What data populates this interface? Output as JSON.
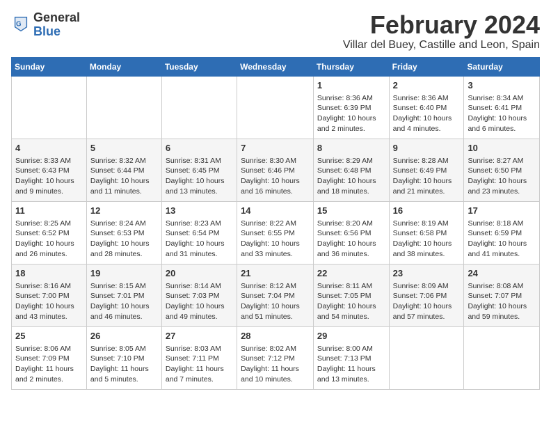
{
  "header": {
    "logo": {
      "general": "General",
      "blue": "Blue",
      "icon_color": "#2e6db4"
    },
    "title": "February 2024",
    "subtitle": "Villar del Buey, Castille and Leon, Spain"
  },
  "weekdays": [
    "Sunday",
    "Monday",
    "Tuesday",
    "Wednesday",
    "Thursday",
    "Friday",
    "Saturday"
  ],
  "weeks": [
    [
      {
        "day": "",
        "content": ""
      },
      {
        "day": "",
        "content": ""
      },
      {
        "day": "",
        "content": ""
      },
      {
        "day": "",
        "content": ""
      },
      {
        "day": "1",
        "content": "Sunrise: 8:36 AM\nSunset: 6:39 PM\nDaylight: 10 hours\nand 2 minutes."
      },
      {
        "day": "2",
        "content": "Sunrise: 8:36 AM\nSunset: 6:40 PM\nDaylight: 10 hours\nand 4 minutes."
      },
      {
        "day": "3",
        "content": "Sunrise: 8:34 AM\nSunset: 6:41 PM\nDaylight: 10 hours\nand 6 minutes."
      }
    ],
    [
      {
        "day": "4",
        "content": "Sunrise: 8:33 AM\nSunset: 6:43 PM\nDaylight: 10 hours\nand 9 minutes."
      },
      {
        "day": "5",
        "content": "Sunrise: 8:32 AM\nSunset: 6:44 PM\nDaylight: 10 hours\nand 11 minutes."
      },
      {
        "day": "6",
        "content": "Sunrise: 8:31 AM\nSunset: 6:45 PM\nDaylight: 10 hours\nand 13 minutes."
      },
      {
        "day": "7",
        "content": "Sunrise: 8:30 AM\nSunset: 6:46 PM\nDaylight: 10 hours\nand 16 minutes."
      },
      {
        "day": "8",
        "content": "Sunrise: 8:29 AM\nSunset: 6:48 PM\nDaylight: 10 hours\nand 18 minutes."
      },
      {
        "day": "9",
        "content": "Sunrise: 8:28 AM\nSunset: 6:49 PM\nDaylight: 10 hours\nand 21 minutes."
      },
      {
        "day": "10",
        "content": "Sunrise: 8:27 AM\nSunset: 6:50 PM\nDaylight: 10 hours\nand 23 minutes."
      }
    ],
    [
      {
        "day": "11",
        "content": "Sunrise: 8:25 AM\nSunset: 6:52 PM\nDaylight: 10 hours\nand 26 minutes."
      },
      {
        "day": "12",
        "content": "Sunrise: 8:24 AM\nSunset: 6:53 PM\nDaylight: 10 hours\nand 28 minutes."
      },
      {
        "day": "13",
        "content": "Sunrise: 8:23 AM\nSunset: 6:54 PM\nDaylight: 10 hours\nand 31 minutes."
      },
      {
        "day": "14",
        "content": "Sunrise: 8:22 AM\nSunset: 6:55 PM\nDaylight: 10 hours\nand 33 minutes."
      },
      {
        "day": "15",
        "content": "Sunrise: 8:20 AM\nSunset: 6:56 PM\nDaylight: 10 hours\nand 36 minutes."
      },
      {
        "day": "16",
        "content": "Sunrise: 8:19 AM\nSunset: 6:58 PM\nDaylight: 10 hours\nand 38 minutes."
      },
      {
        "day": "17",
        "content": "Sunrise: 8:18 AM\nSunset: 6:59 PM\nDaylight: 10 hours\nand 41 minutes."
      }
    ],
    [
      {
        "day": "18",
        "content": "Sunrise: 8:16 AM\nSunset: 7:00 PM\nDaylight: 10 hours\nand 43 minutes."
      },
      {
        "day": "19",
        "content": "Sunrise: 8:15 AM\nSunset: 7:01 PM\nDaylight: 10 hours\nand 46 minutes."
      },
      {
        "day": "20",
        "content": "Sunrise: 8:14 AM\nSunset: 7:03 PM\nDaylight: 10 hours\nand 49 minutes."
      },
      {
        "day": "21",
        "content": "Sunrise: 8:12 AM\nSunset: 7:04 PM\nDaylight: 10 hours\nand 51 minutes."
      },
      {
        "day": "22",
        "content": "Sunrise: 8:11 AM\nSunset: 7:05 PM\nDaylight: 10 hours\nand 54 minutes."
      },
      {
        "day": "23",
        "content": "Sunrise: 8:09 AM\nSunset: 7:06 PM\nDaylight: 10 hours\nand 57 minutes."
      },
      {
        "day": "24",
        "content": "Sunrise: 8:08 AM\nSunset: 7:07 PM\nDaylight: 10 hours\nand 59 minutes."
      }
    ],
    [
      {
        "day": "25",
        "content": "Sunrise: 8:06 AM\nSunset: 7:09 PM\nDaylight: 11 hours\nand 2 minutes."
      },
      {
        "day": "26",
        "content": "Sunrise: 8:05 AM\nSunset: 7:10 PM\nDaylight: 11 hours\nand 5 minutes."
      },
      {
        "day": "27",
        "content": "Sunrise: 8:03 AM\nSunset: 7:11 PM\nDaylight: 11 hours\nand 7 minutes."
      },
      {
        "day": "28",
        "content": "Sunrise: 8:02 AM\nSunset: 7:12 PM\nDaylight: 11 hours\nand 10 minutes."
      },
      {
        "day": "29",
        "content": "Sunrise: 8:00 AM\nSunset: 7:13 PM\nDaylight: 11 hours\nand 13 minutes."
      },
      {
        "day": "",
        "content": ""
      },
      {
        "day": "",
        "content": ""
      }
    ]
  ]
}
